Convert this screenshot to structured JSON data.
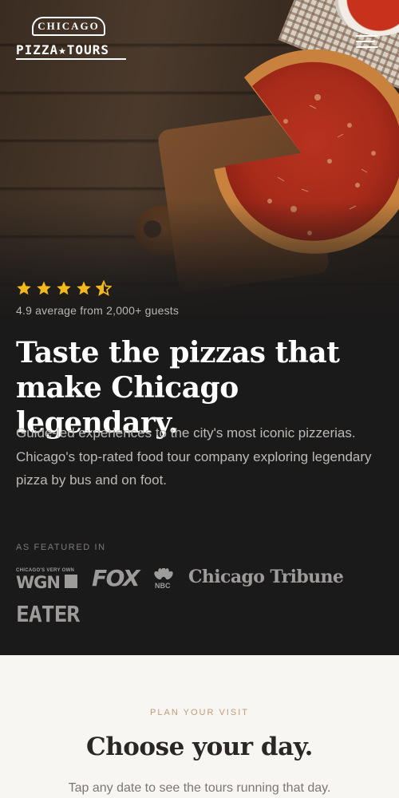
{
  "header": {
    "logo": {
      "top_word": "CHICAGO",
      "bottom_word": "PIZZA★TOURS"
    },
    "menu_icon": "hamburger-icon"
  },
  "hero": {
    "rating": {
      "value": 4.5,
      "max": 5,
      "text": "4.9 average from 2,000+ guests"
    },
    "headline": "Taste the pizzas that make Chicago legendary.",
    "lead": "Guide-led experiences to the city's most iconic pizzerias. Chicago's top-rated food tour company exploring legendary pizza by bus and on foot.",
    "featured": {
      "label": "AS FEATURED IN",
      "logos": {
        "wgn_small": "CHICAGO'S VERY OWN",
        "wgn": "WGN",
        "fox": "FOX",
        "nbc": "NBC",
        "tribune": "Chicago Tribune",
        "eater": "EATER"
      }
    }
  },
  "plan": {
    "eyebrow": "PLAN YOUR VISIT",
    "title": "Choose your day.",
    "subtitle": "Tap any date to see the tours running that day."
  },
  "colors": {
    "hero_bg": "#1b1a1a",
    "star": "#f2b81c",
    "plan_bg": "#f8f6f2",
    "eyebrow": "#c49a77"
  }
}
